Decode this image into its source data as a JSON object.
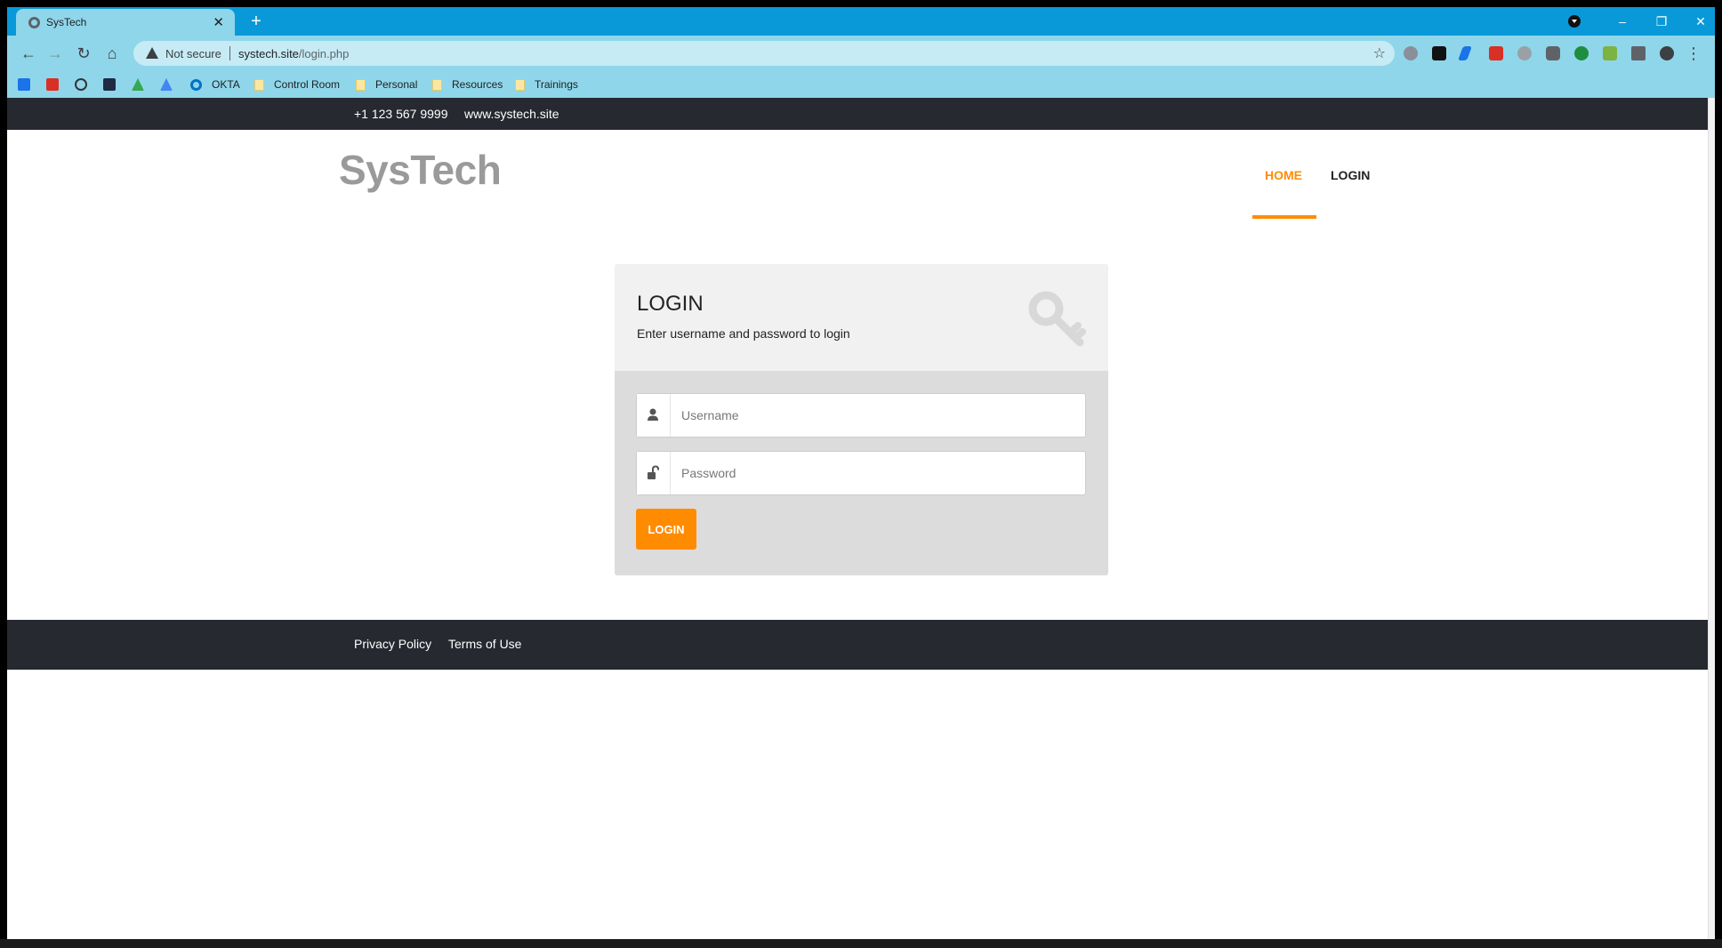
{
  "browser": {
    "tab_title": "SysTech",
    "new_tab_label": "+",
    "security_label": "Not secure",
    "url_domain": "systech.site",
    "url_path": "/login.php",
    "bookmarks": [
      "OKTA",
      "Control Room",
      "Personal",
      "Resources",
      "Trainings"
    ]
  },
  "site": {
    "topbar": {
      "phone": "+1 123 567 9999",
      "website": "www.systech.site"
    },
    "brand": "SysTech",
    "nav": {
      "home": "HOME",
      "login": "LOGIN"
    },
    "login_panel": {
      "title": "LOGIN",
      "subtitle": "Enter username and password to login",
      "username_placeholder": "Username",
      "password_placeholder": "Password",
      "submit_label": "LOGIN"
    },
    "footer": {
      "privacy": "Privacy Policy",
      "terms": "Terms of Use"
    }
  },
  "colors": {
    "accent": "#ff8c00",
    "dark_bar": "#262930",
    "chrome": "#8fd6ea",
    "titlebar": "#0a99d8"
  }
}
